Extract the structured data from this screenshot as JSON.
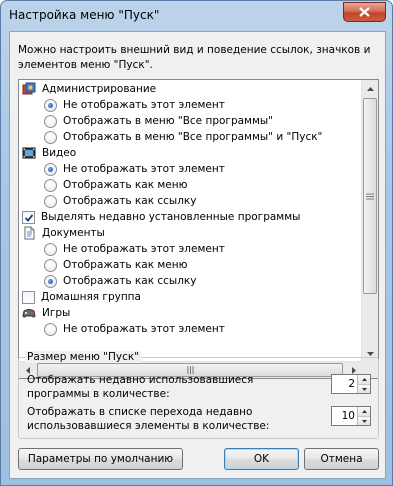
{
  "window": {
    "title": "Настройка меню \"Пуск\""
  },
  "intro": "Можно настроить внешний вид и поведение ссылок, значков и элементов меню \"Пуск\".",
  "list": {
    "admin": {
      "label": "Администрирование",
      "options": [
        "Не отображать этот элемент",
        "Отображать в меню \"Все программы\"",
        "Отображать в меню \"Все программы\" и \"Пуск\""
      ],
      "selected": 0
    },
    "video": {
      "label": "Видео",
      "options": [
        "Не отображать этот элемент",
        "Отображать как меню",
        "Отображать как ссылку"
      ],
      "selected": 0
    },
    "highlight_new": {
      "label": "Выделять недавно установленные программы",
      "checked": true
    },
    "documents": {
      "label": "Документы",
      "options": [
        "Не отображать этот элемент",
        "Отображать как меню",
        "Отображать как ссылку"
      ],
      "selected": 2
    },
    "homegroup": {
      "label": "Домашняя группа",
      "checked": false
    },
    "games": {
      "label": "Игры",
      "options": [
        "Не отображать этот элемент"
      ],
      "selected": 0
    }
  },
  "size_group": {
    "legend": "Размер меню \"Пуск\"",
    "recent_programs_label": "Отображать недавно использовавшиеся программы в количестве:",
    "recent_programs_value": "2",
    "jumplist_label": "Отображать в списке перехода недавно использовавшиеся элементы в количестве:",
    "jumplist_value": "10"
  },
  "buttons": {
    "defaults": "Параметры по умолчанию",
    "ok": "OK",
    "cancel": "Отмена"
  },
  "icons": {
    "admin": "admin-tools-icon",
    "video": "video-library-icon",
    "documents": "documents-icon",
    "games": "games-icon",
    "close": "close-icon"
  }
}
